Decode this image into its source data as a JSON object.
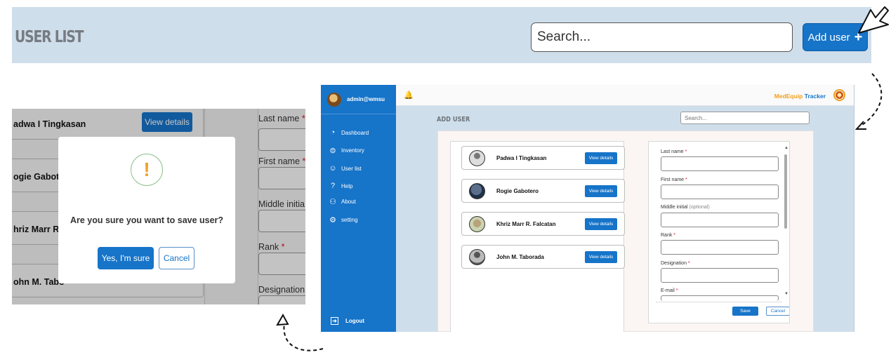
{
  "top_banner": {
    "title": "USER LIST",
    "search_placeholder": "Search...",
    "add_button_label": "Add user",
    "add_button_icon": "plus-icon"
  },
  "dialog_crop": {
    "list_rows": [
      {
        "name": "adwa I Tingkasan",
        "button": "View details"
      },
      {
        "name": "ogie Gabote"
      },
      {
        "name": "hriz Marr R"
      },
      {
        "name": "ohn M. Tabo"
      }
    ],
    "form_labels": [
      {
        "text": "Last name",
        "required": "*"
      },
      {
        "text": "First name",
        "required": "*"
      },
      {
        "text": "Middle initia",
        "required": ""
      },
      {
        "text": "Rank",
        "required": "*"
      },
      {
        "text": "Designation",
        "required": ""
      }
    ],
    "modal": {
      "icon": "exclamation-icon",
      "icon_glyph": "!",
      "message": "Are you sure you want to save user?",
      "confirm_label": "Yes, I'm sure",
      "cancel_label": "Cancel"
    }
  },
  "app": {
    "sidebar": {
      "user": "admin@wmsu",
      "items": [
        {
          "label": "Dashboard",
          "icon": "pie-chart-icon",
          "glyph": "◔"
        },
        {
          "label": "Inventory",
          "icon": "inventory-icon",
          "glyph": "⊜"
        },
        {
          "label": "User list",
          "icon": "user-icon",
          "glyph": "☺"
        },
        {
          "label": "Help",
          "icon": "help-icon",
          "glyph": "?"
        },
        {
          "label": "About",
          "icon": "people-icon",
          "glyph": "⚇"
        },
        {
          "label": "setting",
          "icon": "gear-icon",
          "glyph": "⚙"
        }
      ],
      "logout_label": "Logout",
      "collapse_glyph": "‹"
    },
    "header": {
      "bell_glyph": "🔔",
      "brand_part1": "MedEquip",
      "brand_part2": "Tracker"
    },
    "main": {
      "title": "ADD USER",
      "search_placeholder": "Search...",
      "users": [
        {
          "name": "Padwa I Tingkasan",
          "button": "View details"
        },
        {
          "name": "Rogie Gabotero",
          "button": "View details"
        },
        {
          "name": "Khriz Marr R. Falcatan",
          "button": "View details"
        },
        {
          "name": "John M. Taborada",
          "button": "View details"
        }
      ],
      "form": {
        "fields": [
          {
            "label": "Last name",
            "required": "*",
            "optional": ""
          },
          {
            "label": "First name",
            "required": "*",
            "optional": ""
          },
          {
            "label": "Middle initial",
            "required": "",
            "optional": "(optional)"
          },
          {
            "label": "Rank",
            "required": "*",
            "optional": ""
          },
          {
            "label": "Designation",
            "required": "*",
            "optional": ""
          },
          {
            "label": "E-mail",
            "required": "*",
            "optional": ""
          }
        ],
        "save_label": "Save",
        "cancel_label": "Cancel"
      }
    }
  },
  "colors": {
    "primary": "#1674c9",
    "banner_bg": "#cfdeeb",
    "brand_orange": "#f0a020",
    "required_red": "#dd1122"
  }
}
